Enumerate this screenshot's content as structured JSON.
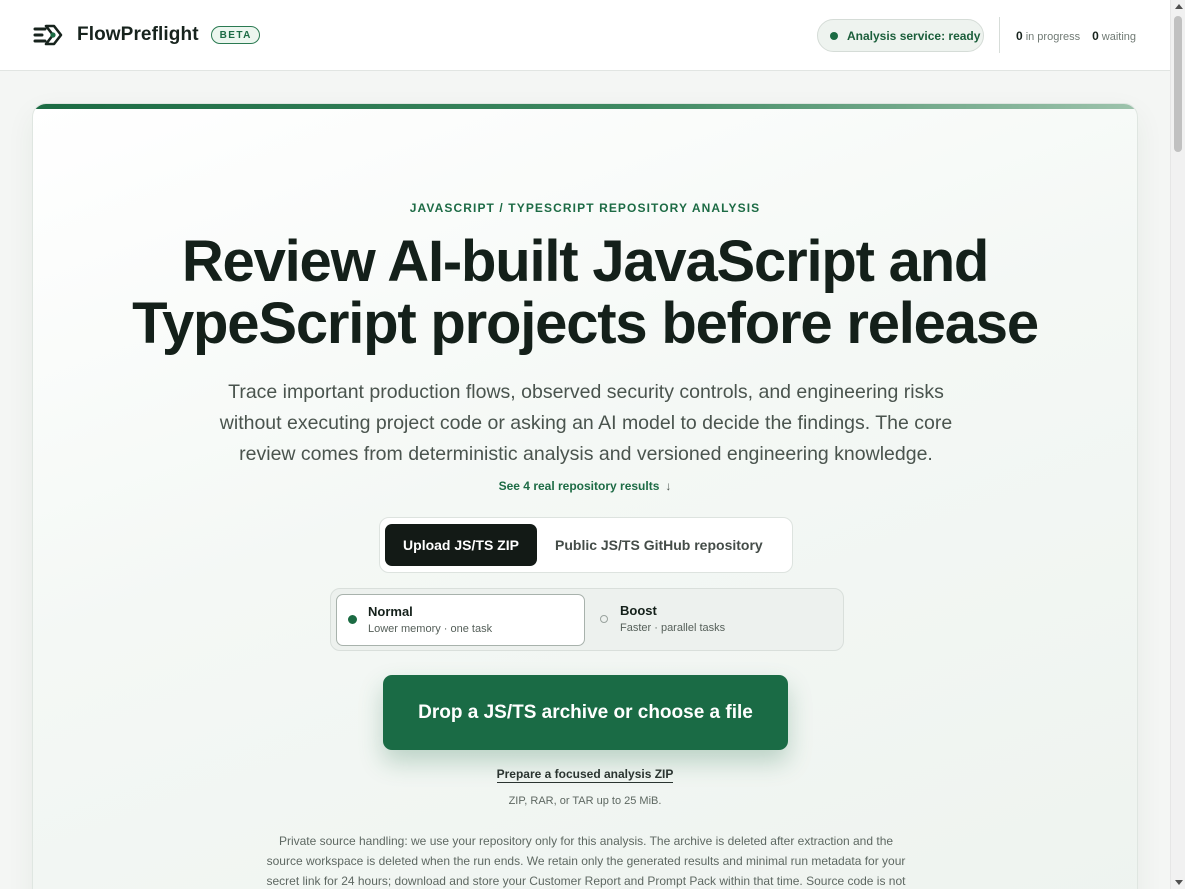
{
  "header": {
    "brand_name": "FlowPreflight",
    "badge": "BETA",
    "service_status": "Analysis service: ready",
    "in_progress_count": "0",
    "in_progress_label": "in progress",
    "waiting_count": "0",
    "waiting_label": "waiting"
  },
  "hero": {
    "eyebrow": "JAVASCRIPT / TYPESCRIPT REPOSITORY ANALYSIS",
    "headline_line1": "Review AI-built JavaScript and",
    "headline_line2": "TypeScript projects before release",
    "subcopy": "Trace important production flows, observed security controls, and engineering risks without executing project code or asking an AI model to decide the findings. The core review comes from deterministic analysis and versioned engineering knowledge.",
    "see_results": "See 4 real repository results",
    "see_results_arrow": "↓"
  },
  "source_tabs": {
    "active": "Upload JS/TS ZIP",
    "other": "Public JS/TS GitHub repository"
  },
  "modes": {
    "normal_title": "Normal",
    "normal_sub": "Lower memory · one task",
    "boost_title": "Boost",
    "boost_sub": "Faster · parallel tasks",
    "selected": "Normal"
  },
  "upload": {
    "drop_label": "Drop a JS/TS archive or choose a file",
    "prepare_link": "Prepare a focused analysis ZIP",
    "formats": "ZIP, RAR, or TAR up to 25 MiB.",
    "privacy_line1": "Private source handling: we use your repository only for this analysis. The archive is deleted after extraction and the",
    "privacy_line2": "source workspace is deleted when the run ends. We retain only the generated results and minimal run metadata for your",
    "privacy_line3": "secret link for 24 hours; download and store your Customer Report and Prompt Pack within that time. Source code is not"
  },
  "colors": {
    "accent": "#1a6b45",
    "ink": "#14201a",
    "muted": "#5e6862"
  },
  "icons": {
    "brand": "flow-logo-icon",
    "status": "status-dot-icon"
  }
}
